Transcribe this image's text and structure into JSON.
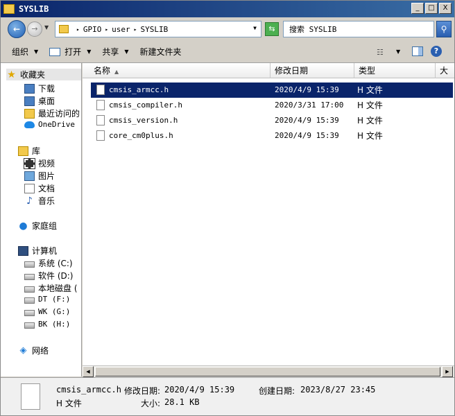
{
  "window": {
    "title": "SYSLIB"
  },
  "title_controls": {
    "min": "_",
    "max": "□",
    "close": "X"
  },
  "address": {
    "crumbs": [
      "GPIO",
      "user",
      "SYSLIB"
    ]
  },
  "search": {
    "placeholder": "搜索 SYSLIB"
  },
  "toolbar": {
    "organize": "组织",
    "open": "打开",
    "share": "共享",
    "new_folder": "新建文件夹"
  },
  "nav": {
    "favorites": {
      "label": "收藏夹",
      "items": [
        "下载",
        "桌面",
        "最近访问的",
        "OneDrive"
      ]
    },
    "libraries": {
      "label": "库",
      "items": [
        "视频",
        "图片",
        "文档",
        "音乐"
      ]
    },
    "homegroup": "家庭组",
    "computer": {
      "label": "计算机",
      "items": [
        "系统 (C:)",
        "软件 (D:)",
        "本地磁盘 (",
        "DT (F:)",
        "WK (G:)",
        "BK (H:)"
      ]
    },
    "network": "网络"
  },
  "columns": {
    "name": "名称",
    "modified": "修改日期",
    "type": "类型",
    "size": "大小"
  },
  "files": [
    {
      "name": "cmsis_armcc.h",
      "modified": "2020/4/9 15:39",
      "type": "H 文件",
      "selected": true
    },
    {
      "name": "cmsis_compiler.h",
      "modified": "2020/3/31 17:00",
      "type": "H 文件",
      "selected": false
    },
    {
      "name": "cmsis_version.h",
      "modified": "2020/4/9 15:39",
      "type": "H 文件",
      "selected": false
    },
    {
      "name": "core_cm0plus.h",
      "modified": "2020/4/9 15:39",
      "type": "H 文件",
      "selected": false
    }
  ],
  "details": {
    "name": "cmsis_armcc.h",
    "modified_label": "修改日期:",
    "modified": "2020/4/9 15:39",
    "created_label": "创建日期:",
    "created": "2023/8/27 23:45",
    "type": "H 文件",
    "size_label": "大小:",
    "size": "28.1 KB"
  }
}
